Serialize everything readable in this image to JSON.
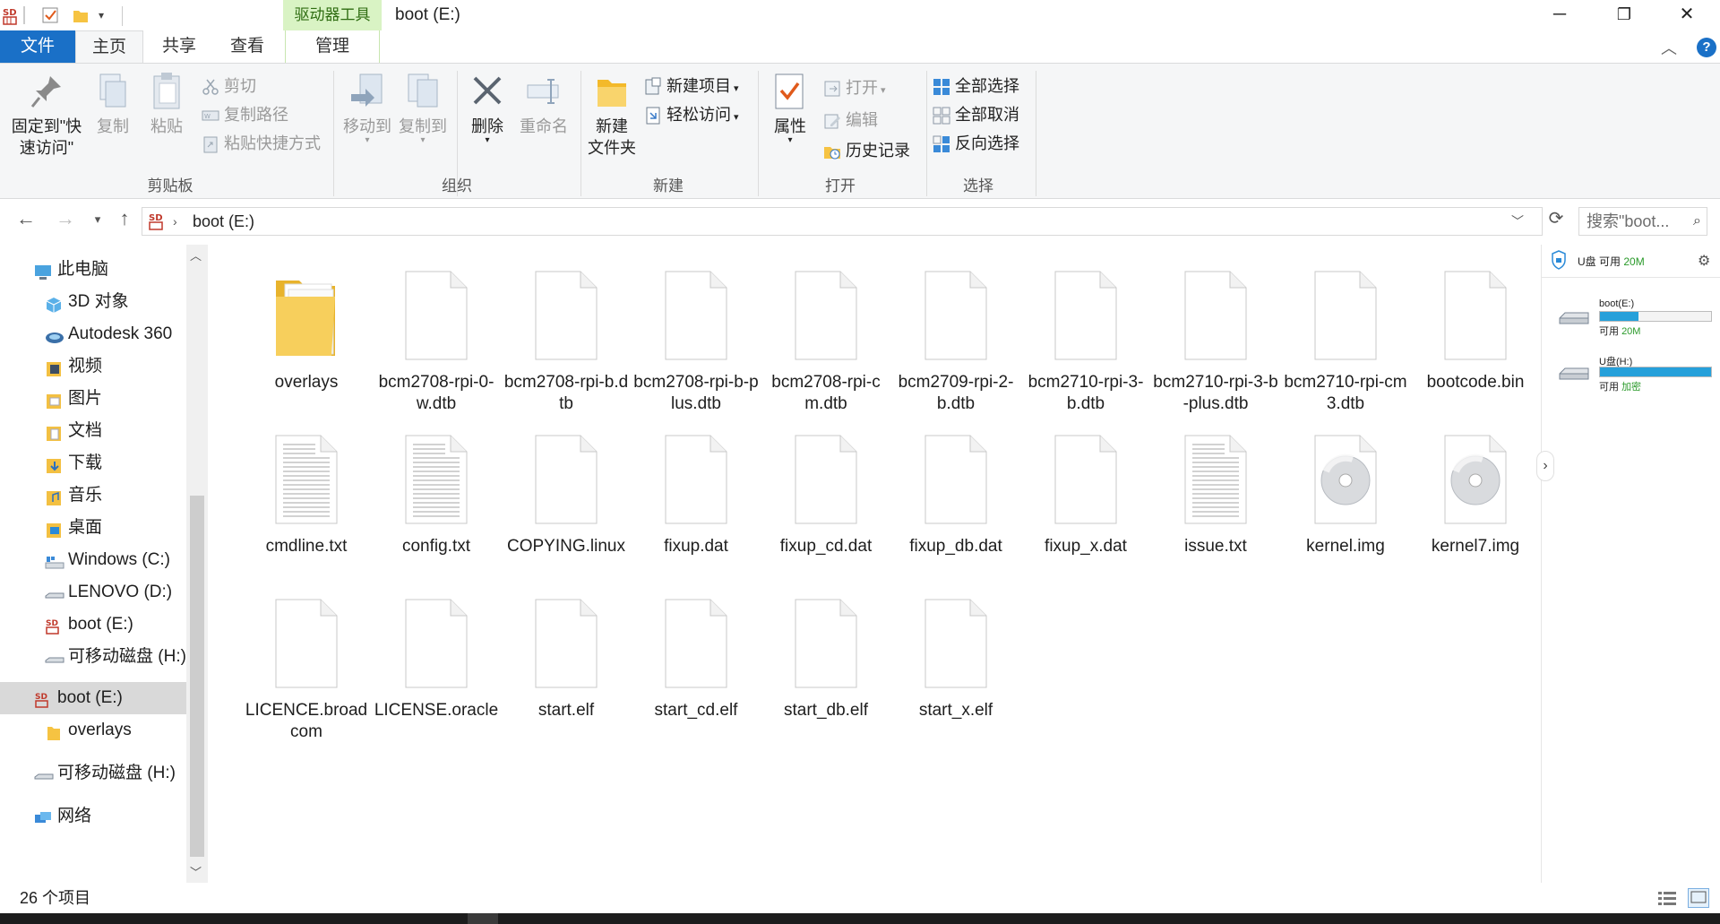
{
  "titlebar": {
    "context_tab": "驱动器工具",
    "title": "boot (E:)",
    "minimize": "─",
    "restore": "❐",
    "close": "✕"
  },
  "tabs": [
    {
      "label": "文件"
    },
    {
      "label": "主页"
    },
    {
      "label": "共享"
    },
    {
      "label": "查看"
    },
    {
      "label": "管理"
    }
  ],
  "ribbon": {
    "clipboard": {
      "pin": "固定到\"快",
      "pin2": "速访问\"",
      "copy": "复制",
      "paste": "粘贴",
      "cut": "剪切",
      "copy_path": "复制路径",
      "paste_shortcut": "粘贴快捷方式",
      "label": "剪贴板"
    },
    "organize": {
      "move_to": "移动到",
      "copy_to": "复制到",
      "delete": "删除",
      "rename": "重命名",
      "label": "组织"
    },
    "new": {
      "new_folder": "新建",
      "new_folder2": "文件夹",
      "new_item": "新建项目",
      "easy_access": "轻松访问",
      "label": "新建"
    },
    "open": {
      "properties": "属性",
      "open": "打开",
      "edit": "编辑",
      "history": "历史记录",
      "label": "打开"
    },
    "select": {
      "select_all": "全部选择",
      "select_none": "全部取消",
      "invert": "反向选择",
      "label": "选择"
    }
  },
  "address": {
    "path": "boot (E:)",
    "search_placeholder": "搜索\"boot..."
  },
  "nav": {
    "items": [
      {
        "label": "此电脑"
      },
      {
        "label": "3D 对象"
      },
      {
        "label": "Autodesk 360"
      },
      {
        "label": "视频"
      },
      {
        "label": "图片"
      },
      {
        "label": "文档"
      },
      {
        "label": "下载"
      },
      {
        "label": "音乐"
      },
      {
        "label": "桌面"
      },
      {
        "label": "Windows (C:)"
      },
      {
        "label": "LENOVO (D:)"
      },
      {
        "label": "boot (E:)"
      },
      {
        "label": "可移动磁盘 (H:)"
      },
      {
        "label": "boot (E:)"
      },
      {
        "label": "overlays"
      },
      {
        "label": "可移动磁盘 (H:)"
      },
      {
        "label": "网络"
      }
    ]
  },
  "files": [
    {
      "name": "overlays",
      "type": "folder"
    },
    {
      "name": "bcm2708-rpi-0-w.dtb",
      "type": "blank"
    },
    {
      "name": "bcm2708-rpi-b.dtb",
      "type": "blank"
    },
    {
      "name": "bcm2708-rpi-b-plus.dtb",
      "type": "blank"
    },
    {
      "name": "bcm2708-rpi-cm.dtb",
      "type": "blank"
    },
    {
      "name": "bcm2709-rpi-2-b.dtb",
      "type": "blank"
    },
    {
      "name": "bcm2710-rpi-3-b.dtb",
      "type": "blank"
    },
    {
      "name": "bcm2710-rpi-3-b-plus.dtb",
      "type": "blank"
    },
    {
      "name": "bcm2710-rpi-cm3.dtb",
      "type": "blank"
    },
    {
      "name": "bootcode.bin",
      "type": "blank"
    },
    {
      "name": "cmdline.txt",
      "type": "text"
    },
    {
      "name": "config.txt",
      "type": "text"
    },
    {
      "name": "COPYING.linux",
      "type": "blank"
    },
    {
      "name": "fixup.dat",
      "type": "blank"
    },
    {
      "name": "fixup_cd.dat",
      "type": "blank"
    },
    {
      "name": "fixup_db.dat",
      "type": "blank"
    },
    {
      "name": "fixup_x.dat",
      "type": "blank"
    },
    {
      "name": "issue.txt",
      "type": "text"
    },
    {
      "name": "kernel.img",
      "type": "disc"
    },
    {
      "name": "kernel7.img",
      "type": "disc"
    },
    {
      "name": "LICENCE.broadcom",
      "type": "blank"
    },
    {
      "name": "LICENSE.oracle",
      "type": "blank"
    },
    {
      "name": "start.elf",
      "type": "blank"
    },
    {
      "name": "start_cd.elf",
      "type": "blank"
    },
    {
      "name": "start_db.elf",
      "type": "blank"
    },
    {
      "name": "start_x.elf",
      "type": "blank"
    }
  ],
  "rightpane": {
    "header_drive": "U盘",
    "header_free_label": "可用",
    "header_free_value": "20M",
    "drives": [
      {
        "name": "boot(E:)",
        "free_label": "可用",
        "free_value": "20M",
        "fill_fraction": 0.35
      },
      {
        "name": "U盘(H:)",
        "free_label": "可用",
        "free_value": "加密",
        "fill_fraction": 1.0
      }
    ]
  },
  "status": {
    "count": "26 个项目"
  },
  "colors": {
    "accent": "#1a70c7",
    "context_tab_bg": "#d9f3c4",
    "drive_bar": "#26a0da"
  }
}
